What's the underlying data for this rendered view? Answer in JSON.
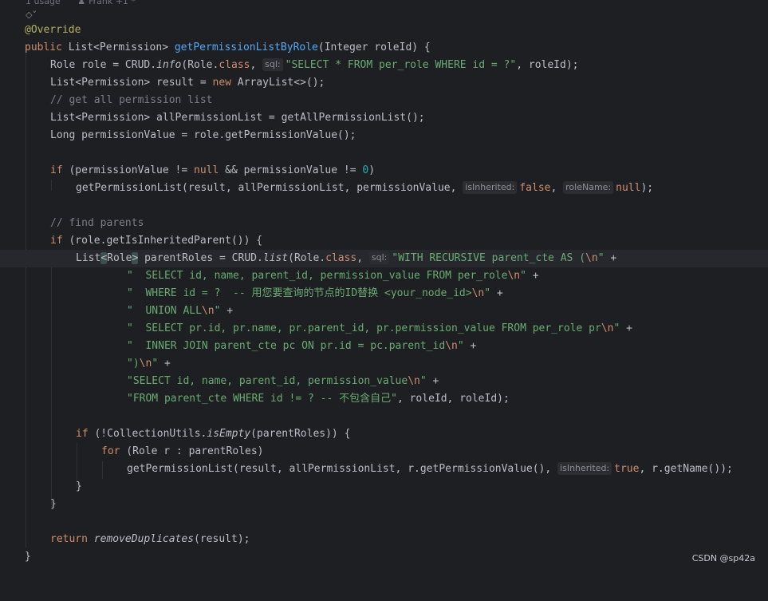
{
  "meta": {
    "usages": "1 usage",
    "authors": "Frank +1 *"
  },
  "hint": "◇˅",
  "code": {
    "annotation": "@Override",
    "signature": {
      "kw_public": "public",
      "ret_type": "List<Permission>",
      "method": "getPermissionListByRole",
      "params": "(Integer roleId) {"
    },
    "l_role_a": "Role role = CRUD.",
    "l_role_info": "info",
    "l_role_b": "(Role.",
    "l_role_class": "class",
    "l_role_c": ", ",
    "inlay_sql": "sql:",
    "l_role_str": "\"SELECT * FROM per_role WHERE id = ?\"",
    "l_role_d": ", roleId);",
    "l_result_a": "List<Permission> result = ",
    "kw_new": "new",
    "l_result_b": " ArrayList<>();",
    "cmt_get_all": "// get all permission list",
    "l_all": "List<Permission> allPermissionList = getAllPermissionList();",
    "l_long": "Long permissionValue = role.getPermissionValue();",
    "kw_if": "if",
    "l_if1_a": " (permissionValue != ",
    "kw_null": "null",
    "l_if1_b": " && permissionValue != ",
    "num_zero": "0",
    "l_if1_c": ")",
    "l_gpl1_a": "getPermissionList(result, allPermissionList, permissionValue, ",
    "inlay_isInherited": "isInherited:",
    "kw_false": "false",
    "l_comma": ", ",
    "inlay_roleName": "roleName:",
    "l_gpl1_end": ");",
    "cmt_find_parents": "// find parents",
    "l_if2_rest": " (role.getIsInheritedParent()) {",
    "l_pr_a": "List",
    "l_pr_lt": "<",
    "l_pr_role": "Role",
    "l_pr_gt": ">",
    "l_pr_b": " parentRoles = CRUD.",
    "l_pr_list": "list",
    "l_pr_c": "(Role.",
    "l_pr_d": ", ",
    "l_pr_str": "\"WITH RECURSIVE parent_cte AS (",
    "esc_n": "\\n",
    "q": "\"",
    "plus": " +",
    "s1": "\"  SELECT id, name, parent_id, permission_value FROM per_role",
    "s2": "\"  WHERE id = ?  -- 用您要查询的节点的ID替换 <your_node_id>",
    "s3": "\"  UNION ALL",
    "s4": "\"  SELECT pr.id, pr.name, pr.parent_id, pr.permission_value FROM per_role pr",
    "s5": "\"  INNER JOIN parent_cte pc ON pr.id = pc.parent_id",
    "s6": "\")",
    "s7": "\"SELECT id, name, parent_id, permission_value",
    "s8": "\"FROM parent_cte WHERE id != ? -- 不包含自己\"",
    "s8_tail": ", roleId, roleId);",
    "l_if3_a": " (!CollectionUtils.",
    "l_if3_isEmpty": "isEmpty",
    "l_if3_b": "(parentRoles)) {",
    "kw_for": "for",
    "l_for": " (Role r : parentRoles)",
    "l_gpl2_a": "getPermissionList(result, allPermissionList, r.getPermissionValue(), ",
    "kw_true": "true",
    "l_gpl2_b": ", r.getName());",
    "close_brace": "}",
    "kw_return": "return",
    "fn_remove": "removeDuplicates",
    "l_return_b": "(result);"
  },
  "watermark": "CSDN @sp42a"
}
